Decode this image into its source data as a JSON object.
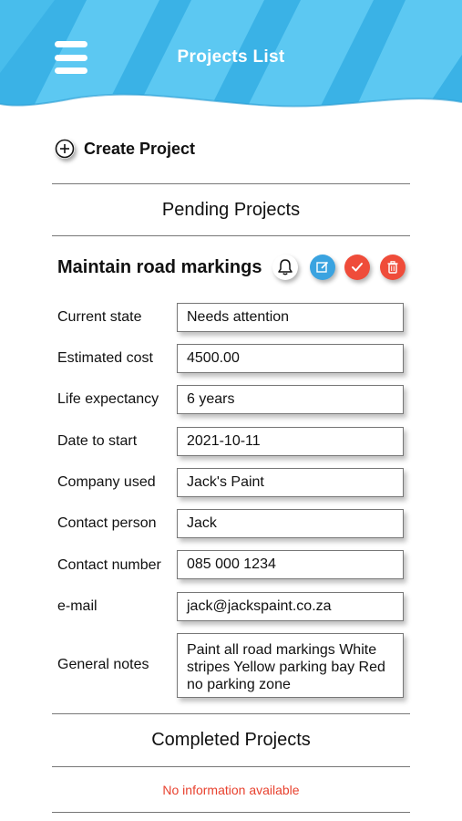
{
  "header": {
    "title": "Projects List",
    "colors": {
      "wave_light": "#5cc8f2",
      "wave_dark": "#3ab2e6"
    }
  },
  "create_project": {
    "label": "Create Project"
  },
  "pending": {
    "section_title": "Pending Projects",
    "project": {
      "name": "Maintain road markings",
      "actions": [
        "bell-icon",
        "edit-icon",
        "check-icon",
        "trash-icon"
      ],
      "fields": {
        "current_state": {
          "label": "Current state",
          "value": "Needs attention"
        },
        "estimated_cost": {
          "label": "Estimated cost",
          "value": "4500.00"
        },
        "life_expectancy": {
          "label": "Life expectancy",
          "value": "6 years"
        },
        "date_to_start": {
          "label": "Date to start",
          "value": "2021-10-11"
        },
        "company_used": {
          "label": "Company used",
          "value": "Jack's Paint"
        },
        "contact_person": {
          "label": "Contact person",
          "value": "Jack"
        },
        "contact_number": {
          "label": "Contact number",
          "value": "085 000 1234"
        },
        "email": {
          "label": "e-mail",
          "value": "jack@jackspaint.co.za"
        },
        "general_notes": {
          "label": "General notes",
          "value": "Paint all road markings White stripes Yellow parking bay Red no parking zone"
        }
      }
    }
  },
  "completed": {
    "section_title": "Completed Projects",
    "empty_text": "No information available",
    "empty_color": "#e8412e"
  }
}
